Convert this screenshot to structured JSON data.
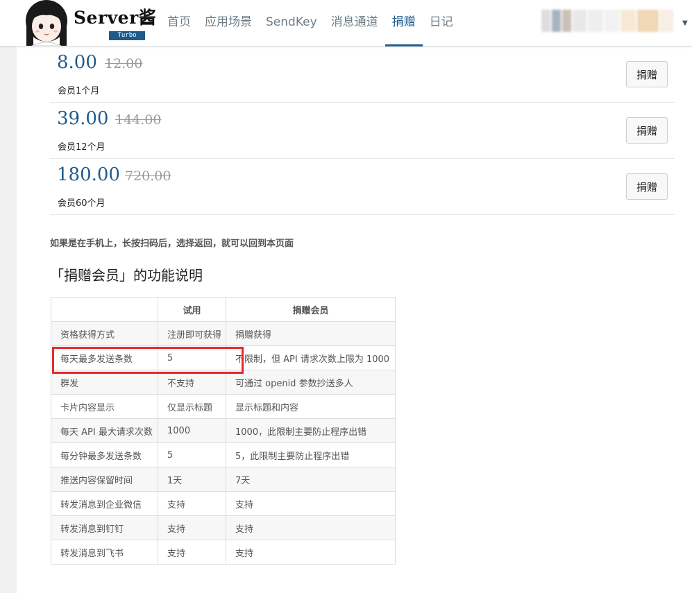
{
  "brand": {
    "name": "Server酱",
    "badge": "Turbo"
  },
  "nav": {
    "items": [
      "首页",
      "应用场景",
      "SendKey",
      "消息通道",
      "捐赠",
      "日记"
    ],
    "active": "捐赠"
  },
  "plans": [
    {
      "price": "8.00",
      "original": "12.00",
      "desc": "会员1个月",
      "button": "捐赠"
    },
    {
      "price": "39.00",
      "original": "144.00",
      "desc": "会员12个月",
      "button": "捐赠"
    },
    {
      "price": "180.00",
      "original": "720.00",
      "desc": "会员60个月",
      "button": "捐赠"
    }
  ],
  "mobile_note": "如果是在手机上，长按扫码后，选择返回，就可以回到本页面",
  "section_title": "「捐赠会员」的功能说明",
  "table": {
    "headers": [
      "",
      "试用",
      "捐赠会员"
    ],
    "rows": [
      [
        "资格获得方式",
        "注册即可获得",
        "捐赠获得"
      ],
      [
        "每天最多发送条数",
        "5",
        "不限制，但 API 请求次数上限为 1000"
      ],
      [
        "群发",
        "不支持",
        "可通过 openid 参数抄送多人"
      ],
      [
        "卡片内容显示",
        "仅显示标题",
        "显示标题和内容"
      ],
      [
        "每天 API 最大请求次数",
        "1000",
        "1000，此限制主要防止程序出错"
      ],
      [
        "每分钟最多发送条数",
        "5",
        "5，此限制主要防止程序出错"
      ],
      [
        "推送内容保留时间",
        "1天",
        "7天"
      ],
      [
        "转发消息到企业微信",
        "支持",
        "支持"
      ],
      [
        "转发消息到钉钉",
        "支持",
        "支持"
      ],
      [
        "转发消息到飞书",
        "支持",
        "支持"
      ]
    ]
  },
  "colors": {
    "accent": "#1e5a8c",
    "highlight": "#e8282d"
  }
}
